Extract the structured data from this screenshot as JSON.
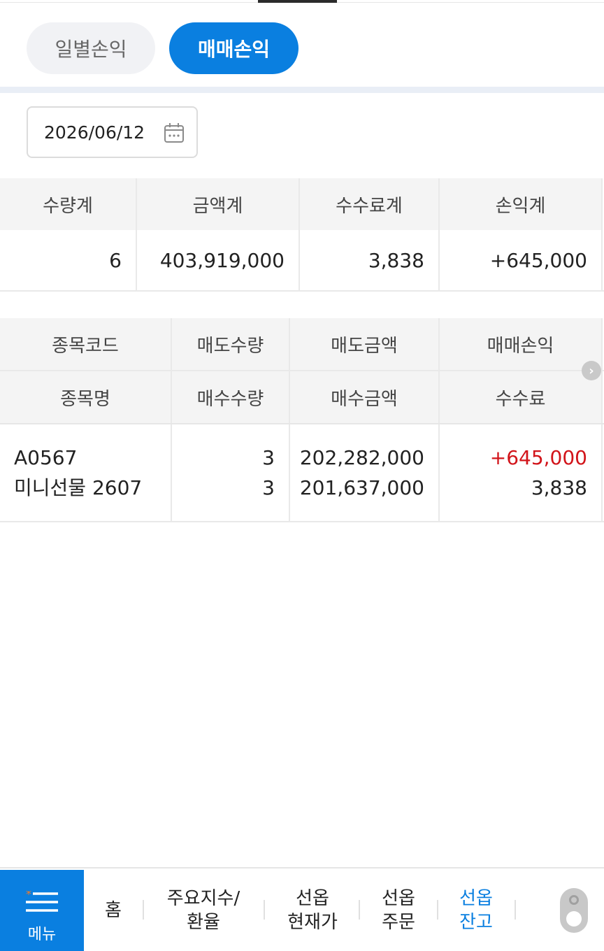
{
  "tabs": {
    "daily": "일별손익",
    "trade": "매매손익"
  },
  "date": "2026/06/12",
  "summary": {
    "headers": [
      "수량계",
      "금액계",
      "수수료계",
      "손익계"
    ],
    "values": [
      "6",
      "403,919,000",
      "3,838",
      "+645,000"
    ]
  },
  "detail": {
    "headers_row1": [
      "종목코드",
      "매도수량",
      "매도금액",
      "매매손익"
    ],
    "headers_row2": [
      "종목명",
      "매수수량",
      "매수금액",
      "수수료"
    ],
    "rows": [
      {
        "code": "A0567",
        "name": "미니선물 2607",
        "sell_qty": "3",
        "buy_qty": "3",
        "sell_amount": "202,282,000",
        "buy_amount": "201,637,000",
        "pnl": "+645,000",
        "fee": "3,838"
      }
    ]
  },
  "nav": {
    "menu": "메뉴",
    "home": "홈",
    "index_l1": "주요지수/",
    "index_l2": "환율",
    "price_l1": "선옵",
    "price_l2": "현재가",
    "order_l1": "선옵",
    "order_l2": "주문",
    "balance_l1": "선옵",
    "balance_l2": "잔고"
  },
  "colors": {
    "accent": "#0a7fe0",
    "positive": "#d2141a",
    "menu_star": "#f07a2a"
  }
}
